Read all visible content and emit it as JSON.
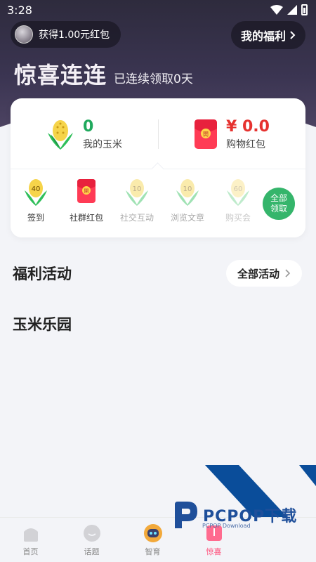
{
  "status_bar": {
    "time": "3:28"
  },
  "header": {
    "reward_text": "获得1.00元红包",
    "welfare_button": "我的福利",
    "title": "惊喜连连",
    "streak_text": "已连续领取0天"
  },
  "stats": {
    "corn": {
      "value": "0",
      "label": "我的玉米"
    },
    "red_packet": {
      "value": "¥ 0.0",
      "label": "购物红包"
    }
  },
  "tasks": [
    {
      "label": "签到",
      "badge": "40"
    },
    {
      "label": "社群红包",
      "badge": "開"
    },
    {
      "label": "社交互动",
      "badge": "10"
    },
    {
      "label": "浏览文章",
      "badge": "10"
    },
    {
      "label": "购买会",
      "badge": "60"
    }
  ],
  "claim_all": {
    "line1": "全部",
    "line2": "领取"
  },
  "sections": {
    "welfare": "福利活动",
    "all_activities": "全部活动",
    "corn_park": "玉米乐园"
  },
  "watermark": {
    "text": "PCPOP下载",
    "sub": "PCPOP Download"
  },
  "tabs": [
    {
      "label": "首页"
    },
    {
      "label": "话题"
    },
    {
      "label": "智育"
    },
    {
      "label": "惊喜"
    }
  ],
  "colors": {
    "green": "#20a95d",
    "red": "#e6322f",
    "accent_pink": "#ff4d79",
    "header_dark": "#2e2b3d"
  }
}
